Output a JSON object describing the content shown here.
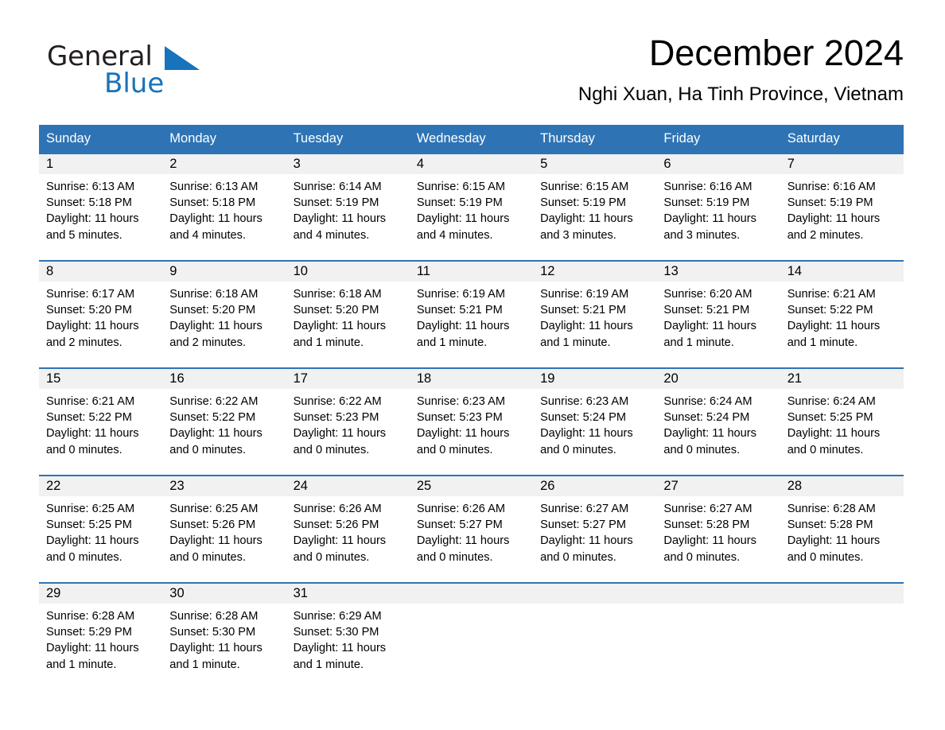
{
  "brand": {
    "name_part1": "General",
    "name_part2": "Blue",
    "logo_triangle_color": "#1773bc",
    "accent_color": "#2e74b5"
  },
  "header": {
    "title": "December 2024",
    "subtitle": "Nghi Xuan, Ha Tinh Province, Vietnam"
  },
  "weekdays": [
    "Sunday",
    "Monday",
    "Tuesday",
    "Wednesday",
    "Thursday",
    "Friday",
    "Saturday"
  ],
  "labels": {
    "sunrise_prefix": "Sunrise:",
    "sunset_prefix": "Sunset:",
    "daylight_prefix": "Daylight:"
  },
  "weeks": [
    [
      {
        "day": "1",
        "sunrise": "Sunrise: 6:13 AM",
        "sunset": "Sunset: 5:18 PM",
        "daylight_line1": "Daylight: 11 hours",
        "daylight_line2": "and 5 minutes."
      },
      {
        "day": "2",
        "sunrise": "Sunrise: 6:13 AM",
        "sunset": "Sunset: 5:18 PM",
        "daylight_line1": "Daylight: 11 hours",
        "daylight_line2": "and 4 minutes."
      },
      {
        "day": "3",
        "sunrise": "Sunrise: 6:14 AM",
        "sunset": "Sunset: 5:19 PM",
        "daylight_line1": "Daylight: 11 hours",
        "daylight_line2": "and 4 minutes."
      },
      {
        "day": "4",
        "sunrise": "Sunrise: 6:15 AM",
        "sunset": "Sunset: 5:19 PM",
        "daylight_line1": "Daylight: 11 hours",
        "daylight_line2": "and 4 minutes."
      },
      {
        "day": "5",
        "sunrise": "Sunrise: 6:15 AM",
        "sunset": "Sunset: 5:19 PM",
        "daylight_line1": "Daylight: 11 hours",
        "daylight_line2": "and 3 minutes."
      },
      {
        "day": "6",
        "sunrise": "Sunrise: 6:16 AM",
        "sunset": "Sunset: 5:19 PM",
        "daylight_line1": "Daylight: 11 hours",
        "daylight_line2": "and 3 minutes."
      },
      {
        "day": "7",
        "sunrise": "Sunrise: 6:16 AM",
        "sunset": "Sunset: 5:19 PM",
        "daylight_line1": "Daylight: 11 hours",
        "daylight_line2": "and 2 minutes."
      }
    ],
    [
      {
        "day": "8",
        "sunrise": "Sunrise: 6:17 AM",
        "sunset": "Sunset: 5:20 PM",
        "daylight_line1": "Daylight: 11 hours",
        "daylight_line2": "and 2 minutes."
      },
      {
        "day": "9",
        "sunrise": "Sunrise: 6:18 AM",
        "sunset": "Sunset: 5:20 PM",
        "daylight_line1": "Daylight: 11 hours",
        "daylight_line2": "and 2 minutes."
      },
      {
        "day": "10",
        "sunrise": "Sunrise: 6:18 AM",
        "sunset": "Sunset: 5:20 PM",
        "daylight_line1": "Daylight: 11 hours",
        "daylight_line2": "and 1 minute."
      },
      {
        "day": "11",
        "sunrise": "Sunrise: 6:19 AM",
        "sunset": "Sunset: 5:21 PM",
        "daylight_line1": "Daylight: 11 hours",
        "daylight_line2": "and 1 minute."
      },
      {
        "day": "12",
        "sunrise": "Sunrise: 6:19 AM",
        "sunset": "Sunset: 5:21 PM",
        "daylight_line1": "Daylight: 11 hours",
        "daylight_line2": "and 1 minute."
      },
      {
        "day": "13",
        "sunrise": "Sunrise: 6:20 AM",
        "sunset": "Sunset: 5:21 PM",
        "daylight_line1": "Daylight: 11 hours",
        "daylight_line2": "and 1 minute."
      },
      {
        "day": "14",
        "sunrise": "Sunrise: 6:21 AM",
        "sunset": "Sunset: 5:22 PM",
        "daylight_line1": "Daylight: 11 hours",
        "daylight_line2": "and 1 minute."
      }
    ],
    [
      {
        "day": "15",
        "sunrise": "Sunrise: 6:21 AM",
        "sunset": "Sunset: 5:22 PM",
        "daylight_line1": "Daylight: 11 hours",
        "daylight_line2": "and 0 minutes."
      },
      {
        "day": "16",
        "sunrise": "Sunrise: 6:22 AM",
        "sunset": "Sunset: 5:22 PM",
        "daylight_line1": "Daylight: 11 hours",
        "daylight_line2": "and 0 minutes."
      },
      {
        "day": "17",
        "sunrise": "Sunrise: 6:22 AM",
        "sunset": "Sunset: 5:23 PM",
        "daylight_line1": "Daylight: 11 hours",
        "daylight_line2": "and 0 minutes."
      },
      {
        "day": "18",
        "sunrise": "Sunrise: 6:23 AM",
        "sunset": "Sunset: 5:23 PM",
        "daylight_line1": "Daylight: 11 hours",
        "daylight_line2": "and 0 minutes."
      },
      {
        "day": "19",
        "sunrise": "Sunrise: 6:23 AM",
        "sunset": "Sunset: 5:24 PM",
        "daylight_line1": "Daylight: 11 hours",
        "daylight_line2": "and 0 minutes."
      },
      {
        "day": "20",
        "sunrise": "Sunrise: 6:24 AM",
        "sunset": "Sunset: 5:24 PM",
        "daylight_line1": "Daylight: 11 hours",
        "daylight_line2": "and 0 minutes."
      },
      {
        "day": "21",
        "sunrise": "Sunrise: 6:24 AM",
        "sunset": "Sunset: 5:25 PM",
        "daylight_line1": "Daylight: 11 hours",
        "daylight_line2": "and 0 minutes."
      }
    ],
    [
      {
        "day": "22",
        "sunrise": "Sunrise: 6:25 AM",
        "sunset": "Sunset: 5:25 PM",
        "daylight_line1": "Daylight: 11 hours",
        "daylight_line2": "and 0 minutes."
      },
      {
        "day": "23",
        "sunrise": "Sunrise: 6:25 AM",
        "sunset": "Sunset: 5:26 PM",
        "daylight_line1": "Daylight: 11 hours",
        "daylight_line2": "and 0 minutes."
      },
      {
        "day": "24",
        "sunrise": "Sunrise: 6:26 AM",
        "sunset": "Sunset: 5:26 PM",
        "daylight_line1": "Daylight: 11 hours",
        "daylight_line2": "and 0 minutes."
      },
      {
        "day": "25",
        "sunrise": "Sunrise: 6:26 AM",
        "sunset": "Sunset: 5:27 PM",
        "daylight_line1": "Daylight: 11 hours",
        "daylight_line2": "and 0 minutes."
      },
      {
        "day": "26",
        "sunrise": "Sunrise: 6:27 AM",
        "sunset": "Sunset: 5:27 PM",
        "daylight_line1": "Daylight: 11 hours",
        "daylight_line2": "and 0 minutes."
      },
      {
        "day": "27",
        "sunrise": "Sunrise: 6:27 AM",
        "sunset": "Sunset: 5:28 PM",
        "daylight_line1": "Daylight: 11 hours",
        "daylight_line2": "and 0 minutes."
      },
      {
        "day": "28",
        "sunrise": "Sunrise: 6:28 AM",
        "sunset": "Sunset: 5:28 PM",
        "daylight_line1": "Daylight: 11 hours",
        "daylight_line2": "and 0 minutes."
      }
    ],
    [
      {
        "day": "29",
        "sunrise": "Sunrise: 6:28 AM",
        "sunset": "Sunset: 5:29 PM",
        "daylight_line1": "Daylight: 11 hours",
        "daylight_line2": "and 1 minute."
      },
      {
        "day": "30",
        "sunrise": "Sunrise: 6:28 AM",
        "sunset": "Sunset: 5:30 PM",
        "daylight_line1": "Daylight: 11 hours",
        "daylight_line2": "and 1 minute."
      },
      {
        "day": "31",
        "sunrise": "Sunrise: 6:29 AM",
        "sunset": "Sunset: 5:30 PM",
        "daylight_line1": "Daylight: 11 hours",
        "daylight_line2": "and 1 minute."
      },
      {
        "day": "",
        "sunrise": "",
        "sunset": "",
        "daylight_line1": "",
        "daylight_line2": ""
      },
      {
        "day": "",
        "sunrise": "",
        "sunset": "",
        "daylight_line1": "",
        "daylight_line2": ""
      },
      {
        "day": "",
        "sunrise": "",
        "sunset": "",
        "daylight_line1": "",
        "daylight_line2": ""
      },
      {
        "day": "",
        "sunrise": "",
        "sunset": "",
        "daylight_line1": "",
        "daylight_line2": ""
      }
    ]
  ]
}
